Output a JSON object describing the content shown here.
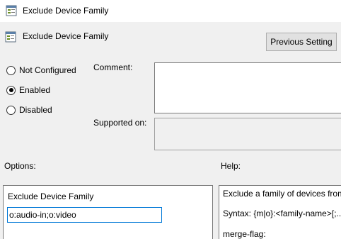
{
  "window": {
    "title": "Exclude Device Family"
  },
  "header": {
    "title": "Exclude Device Family",
    "previous_setting_label": "Previous Setting"
  },
  "state": {
    "options": [
      {
        "label": "Not Configured",
        "checked": false
      },
      {
        "label": "Enabled",
        "checked": true
      },
      {
        "label": "Disabled",
        "checked": false
      }
    ]
  },
  "labels": {
    "comment": "Comment:",
    "supported_on": "Supported on:",
    "options": "Options:",
    "help": "Help:"
  },
  "options_panel": {
    "title": "Exclude Device Family",
    "value": "o:audio-in;o:video"
  },
  "help_panel": {
    "lines": [
      "Exclude a family of devices from",
      "Syntax: {m|o}:<family-name>[;..",
      "merge-flag:"
    ]
  },
  "icons": {
    "app": "policy-icon",
    "header": "policy-icon"
  }
}
